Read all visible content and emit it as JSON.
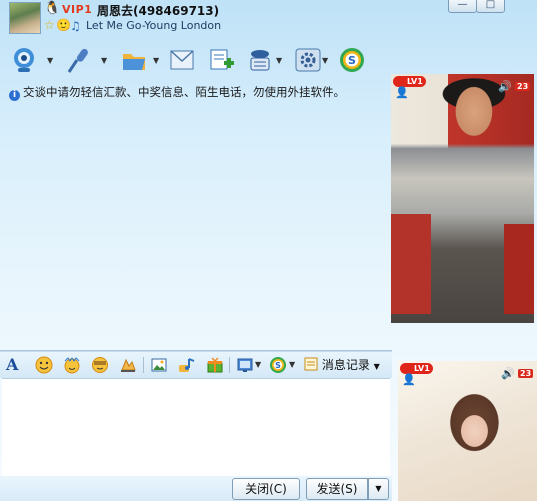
{
  "window": {
    "vip_label": "VIP1",
    "contact_name": "周恩去(498469713)",
    "song": "Let Me Go-Young London",
    "controls": {
      "minimize": "—",
      "maximize": "□"
    }
  },
  "toolbar": {
    "items": [
      {
        "icon": "webcam-icon",
        "has_dropdown": true
      },
      {
        "icon": "microphone-icon",
        "has_dropdown": true
      },
      {
        "icon": "folder-icon",
        "has_dropdown": true
      },
      {
        "icon": "mail-icon",
        "has_dropdown": false
      },
      {
        "icon": "add-note-icon",
        "has_dropdown": false
      },
      {
        "icon": "contact-card-icon",
        "has_dropdown": true
      },
      {
        "icon": "settings-icon",
        "has_dropdown": true
      },
      {
        "icon": "soso-icon",
        "has_dropdown": false
      }
    ]
  },
  "chat": {
    "notice": "交谈中请勿轻信汇款、中奖信息、陌生电话，勿使用外挂软件。",
    "notice_icon": "info-icon"
  },
  "format_bar": {
    "items": [
      "font-icon",
      "smiley-icon",
      "magic-face-icon",
      "voice-emoticon-icon",
      "shake-icon",
      "image-icon",
      "music-icon",
      "gift-icon",
      "screenshot-icon",
      "soso-icon"
    ],
    "history_label": "消息记录"
  },
  "buttons": {
    "close_label": "关闭(C)",
    "send_label": "发送(S)"
  },
  "video": {
    "remote": {
      "level": "LV1",
      "volume_badge": "23"
    },
    "local": {
      "level": "LV1",
      "volume_badge": "23"
    }
  },
  "colors": {
    "accent": "#2d6fd1",
    "badge_red": "#e0261b",
    "window_bg_top": "#bfe2f7"
  }
}
